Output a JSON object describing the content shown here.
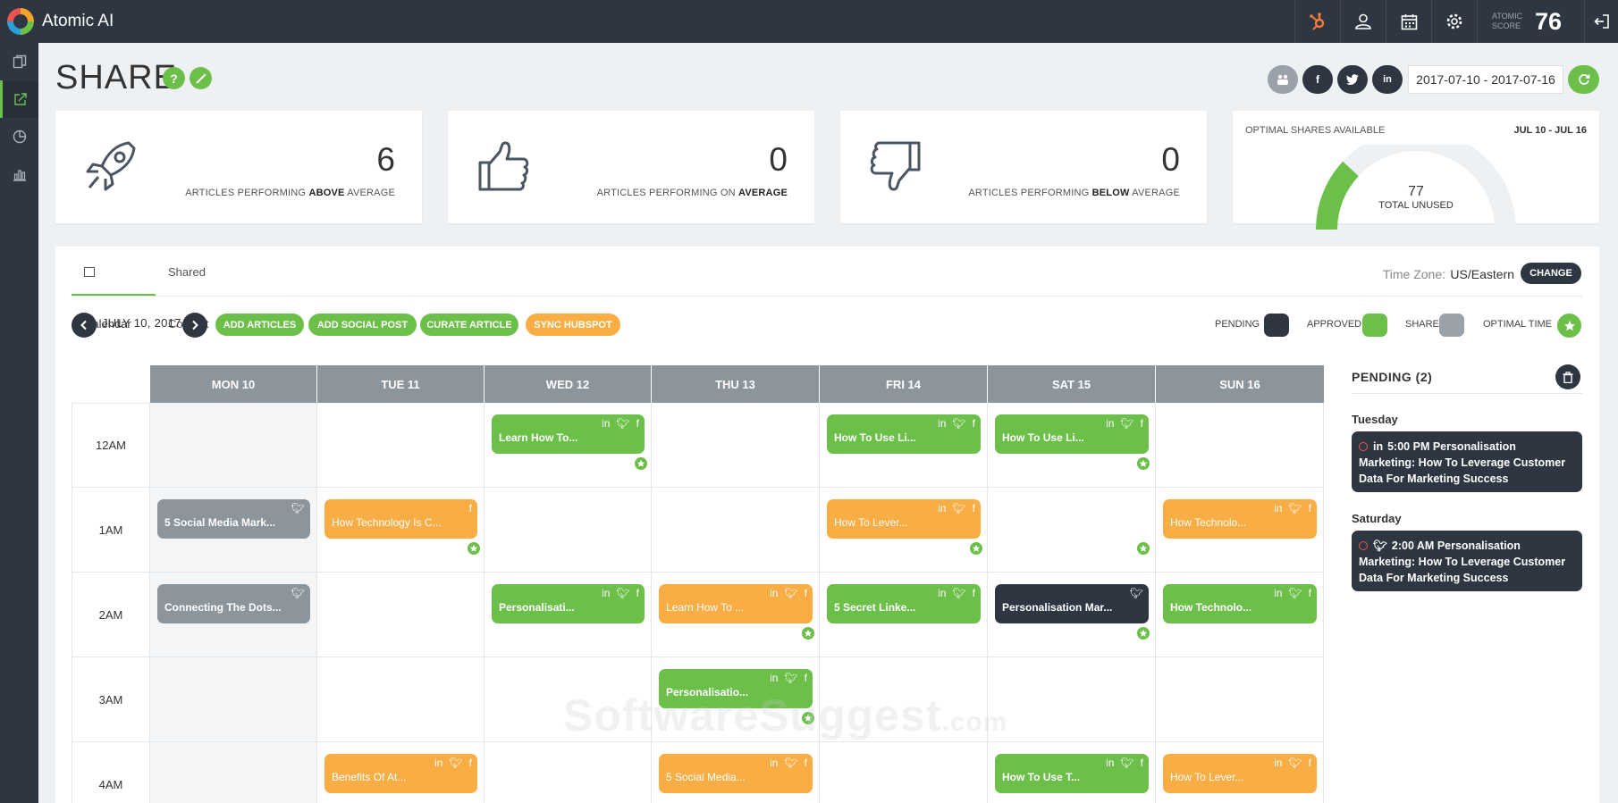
{
  "app": {
    "title": "Atomic AI"
  },
  "topbar": {
    "score_label": "ATOMIC SCORE",
    "score_value": "76"
  },
  "page": {
    "title": "SHARE",
    "date_range": "2017-07-10 - 2017-07-16"
  },
  "stats": [
    {
      "value": "6",
      "label_pre": "ARTICLES PERFORMING ",
      "label_bold": "ABOVE",
      "label_post": " AVERAGE"
    },
    {
      "value": "0",
      "label_pre": "ARTICLES PERFORMING ON ",
      "label_bold": "AVERAGE",
      "label_post": ""
    },
    {
      "value": "0",
      "label_pre": "ARTICLES PERFORMING ",
      "label_bold": "BELOW",
      "label_post": " AVERAGE"
    }
  ],
  "optimal": {
    "title": "OPTIMAL SHARES AVAILABLE",
    "range": "JUL 10 - JUL 16",
    "value": "77",
    "sub": "TOTAL UNUSED"
  },
  "tabs": {
    "calendar": "Calendar",
    "shared": "Shared Content"
  },
  "timezone": {
    "label": "Time Zone:",
    "value": "US/Eastern",
    "change": "CHANGE"
  },
  "toolbar": {
    "date": "JULY 10, 2017",
    "add_articles": "ADD ARTICLES",
    "add_social": "ADD SOCIAL POST",
    "curate": "CURATE ARTICLE",
    "sync": "SYNC HUBSPOT"
  },
  "legend": {
    "pending": "PENDING",
    "approved": "APPROVED",
    "share": "SHARE",
    "optimal": "OPTIMAL TIME"
  },
  "colors": {
    "green": "#6cc04a",
    "orange": "#f8ad45",
    "gray": "#8c949c",
    "dark": "#2e3641"
  },
  "days": [
    "MON 10",
    "TUE 11",
    "WED 12",
    "THU 13",
    "FRI 14",
    "SAT 15",
    "SUN 16"
  ],
  "hours": [
    "12AM",
    "1AM",
    "2AM",
    "3AM",
    "4AM"
  ],
  "events": {
    "e1": "Learn How To...",
    "e2": "How To Use Li...",
    "e3": "How To Use Li...",
    "e4": "5 Social Media Mark...",
    "e5": "How Technology Is C...",
    "e6": "How To Lever...",
    "e7": "How Technolo...",
    "e8": "Connecting The Dots...",
    "e9": "Personalisati...",
    "e10": "Learn How To ...",
    "e11": "5 Secret Linke...",
    "e12": "Personalisation Mar...",
    "e13": "How Technolo...",
    "e14": "Personalisatio...",
    "e15": "Benefits Of At...",
    "e16": "5 Social Media...",
    "e17": "How To Use T...",
    "e18": "How To Lever..."
  },
  "pending": {
    "title": "PENDING (2)",
    "day1": "Tuesday",
    "item1": "5:00 PM Personalisation Marketing: How To Leverage Customer Data For Marketing Success",
    "day2": "Saturday",
    "item2": "2:00 AM Personalisation Marketing: How To Leverage Customer Data For Marketing Success"
  },
  "watermark": {
    "main": "SoftwareSuggest",
    "tld": ".com"
  }
}
